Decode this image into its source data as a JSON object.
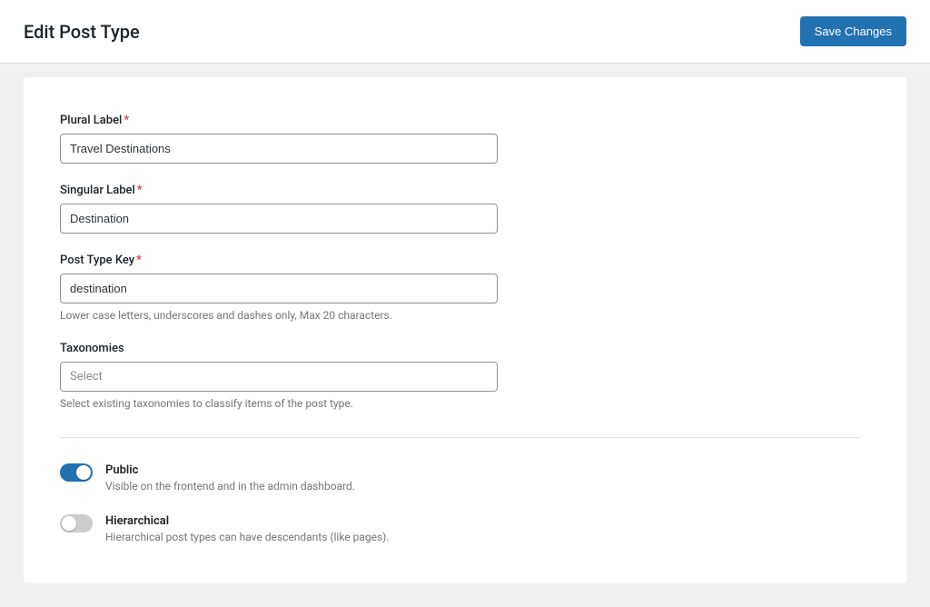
{
  "header": {
    "title": "Edit Post Type",
    "save_label": "Save Changes"
  },
  "fields": {
    "plural": {
      "label": "Plural Label",
      "required": "*",
      "value": "Travel Destinations"
    },
    "singular": {
      "label": "Singular Label",
      "required": "*",
      "value": "Destination"
    },
    "key": {
      "label": "Post Type Key",
      "required": "*",
      "value": "destination",
      "help": "Lower case letters, underscores and dashes only, Max 20 characters."
    },
    "taxonomies": {
      "label": "Taxonomies",
      "placeholder": "Select",
      "help": "Select existing taxonomies to classify items of the post type."
    }
  },
  "toggles": {
    "public": {
      "title": "Public",
      "desc": "Visible on the frontend and in the admin dashboard.",
      "on": true
    },
    "hierarchical": {
      "title": "Hierarchical",
      "desc": "Hierarchical post types can have descendants (like pages).",
      "on": false
    }
  }
}
